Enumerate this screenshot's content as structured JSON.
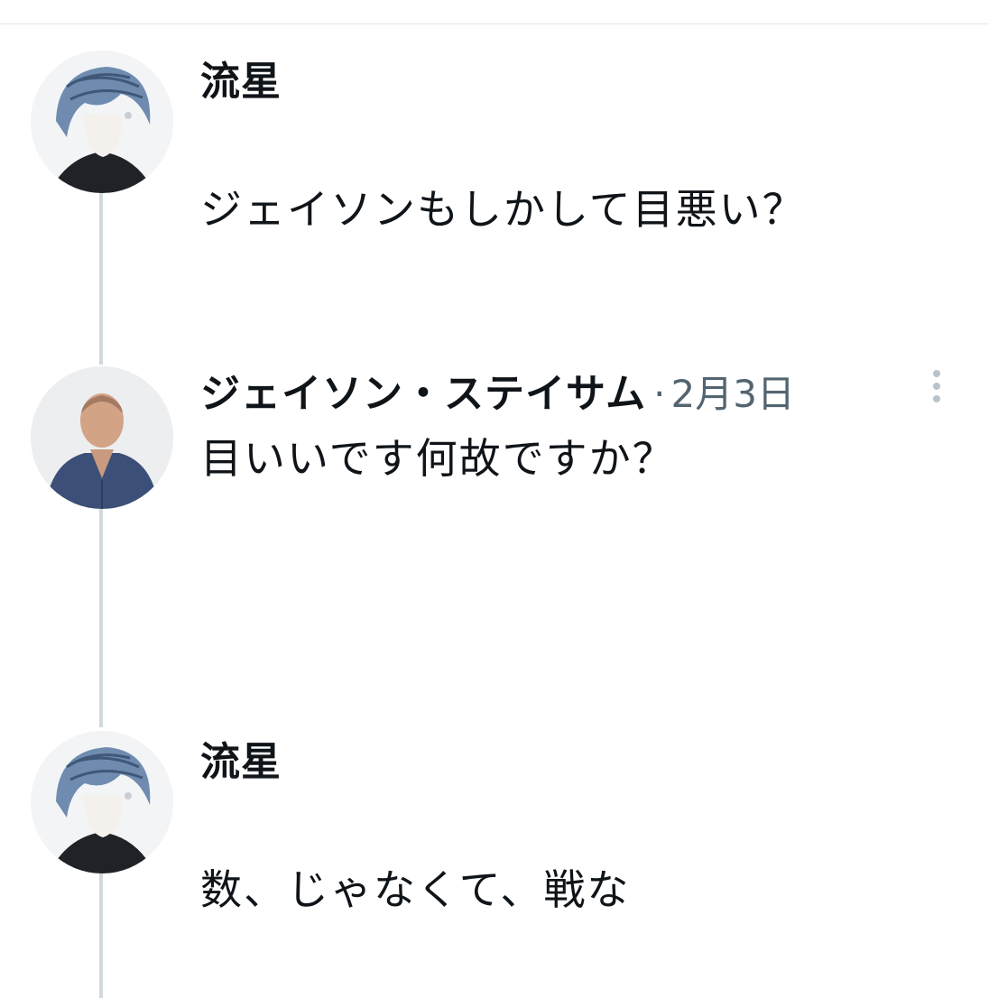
{
  "posts": [
    {
      "author": "流星",
      "date": "",
      "text": "ジェイソンもしかして目悪い？",
      "avatar_icon": "anime-avatar-icon"
    },
    {
      "author": "ジェイソン・ステイサム",
      "date": "2月3日",
      "text": "目いいです何故ですか？",
      "avatar_icon": "photo-avatar-icon",
      "more_icon": "more-vertical-icon"
    },
    {
      "author": "流星",
      "date": "",
      "text": "数、じゃなくて、戦な",
      "avatar_icon": "anime-avatar-icon"
    }
  ],
  "meta_separator": "·",
  "colors": {
    "text": "#0f1419",
    "secondary": "#536471",
    "thread_line": "#cfd9de",
    "divider": "#e3e6e8"
  }
}
